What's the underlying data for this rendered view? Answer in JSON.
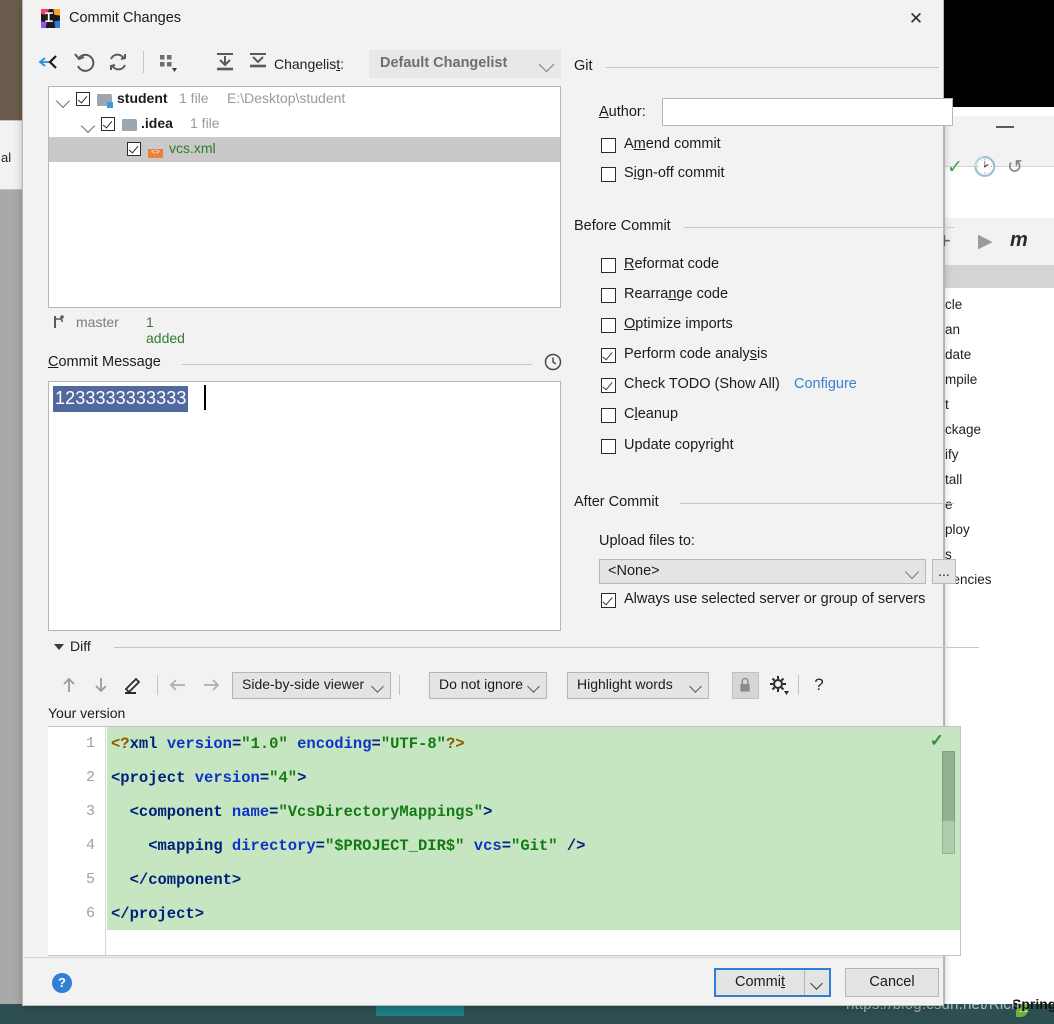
{
  "background": {
    "maven_items": [
      "cle",
      "an",
      "date",
      "mpile",
      "t",
      "ckage",
      "ify",
      "tall",
      "e",
      "ploy",
      "s",
      "dencies"
    ],
    "left_label": "al",
    "spring_text": "Spring Configuration Check",
    "watermark": "https://blog.csdn.net/Rich_"
  },
  "dialog": {
    "title": "Commit Changes",
    "close_label": "✕"
  },
  "toolbar": {
    "changelist_label_pre": "Changelis",
    "changelist_label_key": "t",
    "changelist_label_post": ":",
    "changelist_value": "Default Changelist",
    "icons": [
      "collapse-to-arrow-icon",
      "rollback-icon",
      "refresh-icon",
      "group-by-icon",
      "expand-all-icon",
      "collapse-all-icon"
    ]
  },
  "tree": {
    "rows": [
      {
        "name": "student",
        "file_count": "1 file",
        "path": "E:\\Desktop\\student",
        "checked": true,
        "expanded": true
      },
      {
        "name": ".idea",
        "file_count": "1 file",
        "path": "",
        "checked": true,
        "expanded": true
      },
      {
        "name": "vcs.xml",
        "file_count": "",
        "path": "",
        "checked": true,
        "selected": true
      }
    ]
  },
  "branch": {
    "name": "master",
    "status": "1 added"
  },
  "commit_message": {
    "title_key": "C",
    "title_rest": "ommit Message",
    "value": "1233333333333",
    "history_icon": "clock-icon"
  },
  "git_section": {
    "title": "Git",
    "author_label_key": "A",
    "author_label_rest": "uthor:",
    "author_value": "",
    "checkboxes": [
      {
        "label_pre": "A",
        "label_key": "m",
        "label_post": "end commit",
        "checked": false
      },
      {
        "label_pre": "S",
        "label_key": "ig",
        "label_post": "n-off commit",
        "checked": false
      }
    ]
  },
  "before_commit": {
    "title": "Before Commit",
    "checkboxes": [
      {
        "label_pre": "",
        "label_key": "R",
        "label_post": "eformat code",
        "checked": false
      },
      {
        "label_pre": "Rearra",
        "label_key": "n",
        "label_post": "ge code",
        "checked": false
      },
      {
        "label_pre": "",
        "label_key": "O",
        "label_post": "ptimize imports",
        "checked": false
      },
      {
        "label_pre": "Perform code analy",
        "label_key": "s",
        "label_post": "is",
        "checked": true
      },
      {
        "label_pre": "Check TODO (Show All)",
        "label_key": "",
        "label_post": "",
        "checked": true
      },
      {
        "label_pre": "C",
        "label_key": "l",
        "label_post": "eanup",
        "checked": false
      },
      {
        "label_pre": "Update copyright",
        "label_key": "",
        "label_post": "",
        "checked": false
      }
    ],
    "configure_link": "Configure"
  },
  "after_commit": {
    "title": "After Commit",
    "upload_label": "Upload files to:",
    "upload_value": "<None>",
    "browse_label": "...",
    "always_use_checkbox": {
      "label": "Always use selected server or group of servers",
      "checked": true
    }
  },
  "diff": {
    "section_label": "Diff",
    "nav_icons": [
      "prev-difference-icon",
      "next-difference-icon",
      "edit-icon",
      "accept-left-icon",
      "accept-right-icon"
    ],
    "viewer_mode": "Side-by-side viewer",
    "ignore_mode": "Do not ignore",
    "highlight_mode": "Highlight words",
    "lock_icon": "lock-icon",
    "settings_icon": "gear-icon",
    "help_icon": "?",
    "pane_label": "Your version",
    "line_numbers": [
      "1",
      "2",
      "3",
      "4",
      "5",
      "6"
    ],
    "code_lines": [
      [
        {
          "t": "<?",
          "c": "pi"
        },
        {
          "t": "xml",
          "c": "tag"
        },
        {
          "t": " ",
          "c": "plain"
        },
        {
          "t": "version",
          "c": "attr"
        },
        {
          "t": "=",
          "c": "tag"
        },
        {
          "t": "\"1.0\"",
          "c": "val"
        },
        {
          "t": " ",
          "c": "plain"
        },
        {
          "t": "encoding",
          "c": "attr"
        },
        {
          "t": "=",
          "c": "tag"
        },
        {
          "t": "\"UTF-8\"",
          "c": "val"
        },
        {
          "t": "?>",
          "c": "pi"
        }
      ],
      [
        {
          "t": "<project ",
          "c": "tag"
        },
        {
          "t": "version",
          "c": "attr"
        },
        {
          "t": "=",
          "c": "tag"
        },
        {
          "t": "\"4\"",
          "c": "val"
        },
        {
          "t": ">",
          "c": "tag"
        }
      ],
      [
        {
          "t": "  <component ",
          "c": "tag"
        },
        {
          "t": "name",
          "c": "attr"
        },
        {
          "t": "=",
          "c": "tag"
        },
        {
          "t": "\"VcsDirectoryMappings\"",
          "c": "val"
        },
        {
          "t": ">",
          "c": "tag"
        }
      ],
      [
        {
          "t": "    <mapping ",
          "c": "tag"
        },
        {
          "t": "directory",
          "c": "attr"
        },
        {
          "t": "=",
          "c": "tag"
        },
        {
          "t": "\"$PROJECT_DIR$\"",
          "c": "val"
        },
        {
          "t": " ",
          "c": "plain"
        },
        {
          "t": "vcs",
          "c": "attr"
        },
        {
          "t": "=",
          "c": "tag"
        },
        {
          "t": "\"Git\"",
          "c": "val"
        },
        {
          "t": " />",
          "c": "tag"
        }
      ],
      [
        {
          "t": "  </component>",
          "c": "tag"
        }
      ],
      [
        {
          "t": "</project>",
          "c": "tag"
        }
      ]
    ]
  },
  "footer": {
    "help_label": "?",
    "commit_pre": "Commi",
    "commit_key": "t",
    "commit_post": "",
    "cancel_label": "Cancel"
  },
  "colors": {
    "accent_blue": "#2f7fd4",
    "diff_added_bg": "#c6e6c2",
    "selection_blue": "#51699e",
    "green_text": "#2f7d32",
    "link_blue": "#3a7fd1"
  }
}
